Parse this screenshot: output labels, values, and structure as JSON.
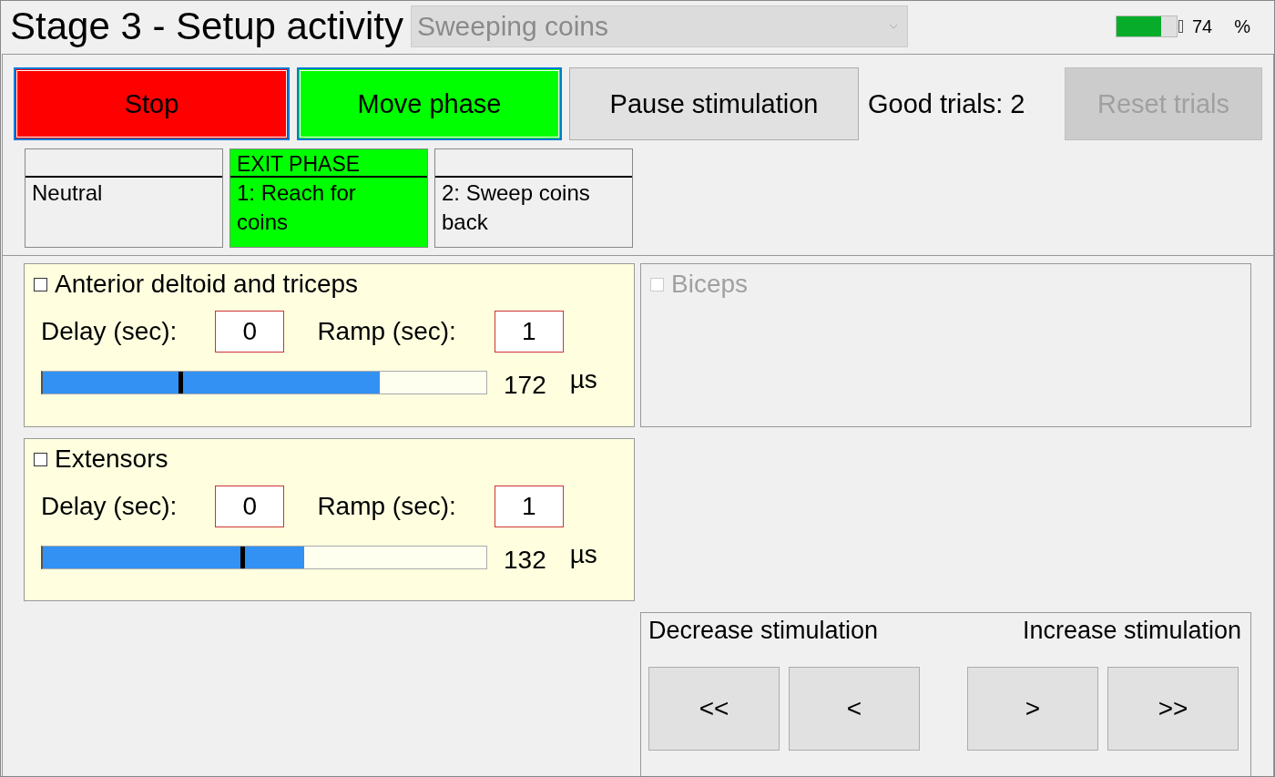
{
  "header": {
    "title": "Stage 3 - Setup activity",
    "activity": {
      "value": "Sweeping coins",
      "disabled": true
    },
    "battery": {
      "level": 0.74,
      "reading": "74",
      "unit": "%"
    }
  },
  "controls": [
    {
      "label": "Stop",
      "kind": "stop"
    },
    {
      "label": "Move phase",
      "kind": "move"
    },
    {
      "label": "Pause stimulation",
      "kind": "plain"
    }
  ],
  "good_trials": "Good trials: 2",
  "reset": {
    "label": "Reset trials",
    "disabled": true
  },
  "phases": [
    {
      "label": "Neutral",
      "selected": false
    },
    {
      "header": "EXIT PHASE",
      "label": "1: Reach for coins",
      "selected": true
    },
    {
      "label": "2: Sweep coins back",
      "selected": false
    }
  ],
  "muscles": [
    {
      "name": "Anterior deltoid and triceps",
      "checked": false,
      "disabled": false,
      "delay_label": "Delay (sec):",
      "delay": "0",
      "ramp_label": "Ramp (sec):",
      "ramp": "1",
      "meter": {
        "level": 0.76
      },
      "thumb": {
        "level": 0.31
      },
      "reading": "172",
      "unit": "µs"
    },
    {
      "name": "Biceps",
      "checked": false,
      "disabled": true
    },
    {
      "name": "Extensors",
      "checked": false,
      "disabled": false,
      "delay_label": "Delay (sec):",
      "delay": "0",
      "ramp_label": "Ramp (sec):",
      "ramp": "1",
      "meter": {
        "level": 0.59
      },
      "thumb": {
        "level": 0.45
      },
      "reading": "132",
      "unit": "µs"
    }
  ],
  "stimulation": {
    "decrease_label": "Decrease stimulation",
    "increase_label": "Increase stimulation",
    "decrease_buttons": [
      "<<",
      "<"
    ],
    "increase_buttons": [
      ">",
      ">>"
    ]
  }
}
